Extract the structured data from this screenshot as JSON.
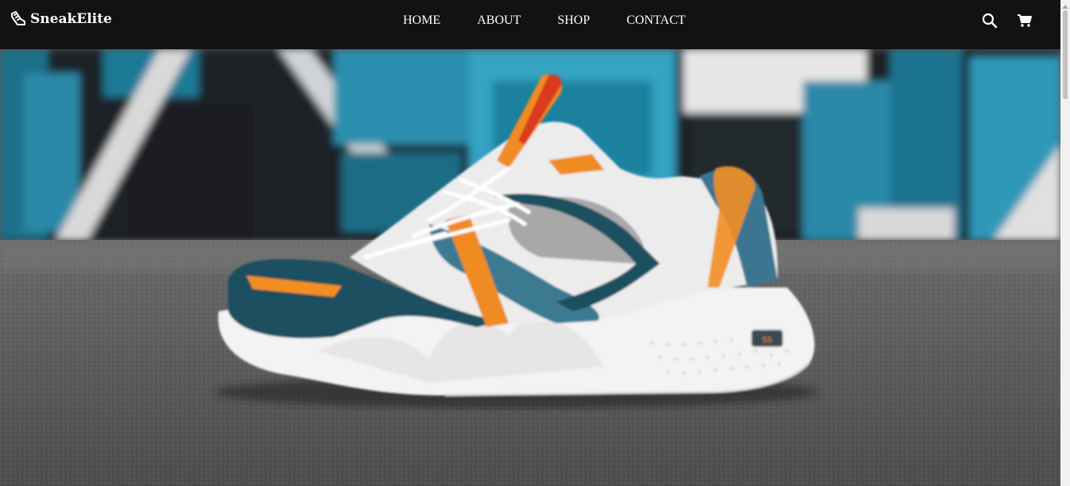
{
  "brand": {
    "name": "SneakElite",
    "icon": "sneaker-icon"
  },
  "nav": {
    "links": [
      {
        "label": "HOME"
      },
      {
        "label": "ABOUT"
      },
      {
        "label": "SHOP"
      },
      {
        "label": "CONTACT"
      }
    ]
  },
  "actions": {
    "search_icon": "search-icon",
    "cart_icon": "cart-icon"
  },
  "hero": {
    "image": "sneaker-photo",
    "subject": "white, teal and orange running sneaker on asphalt in front of graffiti wall"
  },
  "colors": {
    "navbar": "#121212",
    "text": "#ffffff",
    "accent_orange": "#f08a24",
    "accent_teal": "#1f4f5f"
  }
}
